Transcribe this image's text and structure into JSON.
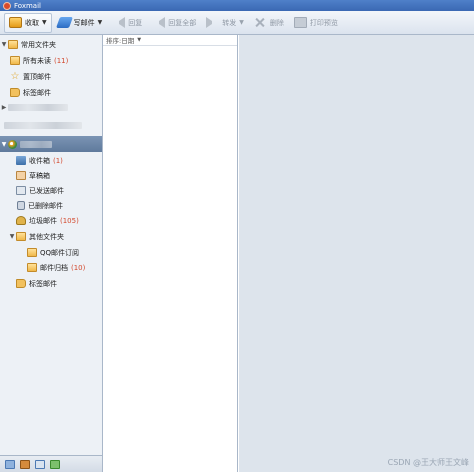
{
  "window": {
    "title": "Foxmail"
  },
  "toolbar": {
    "receive": "收取",
    "compose": "写邮件",
    "reply": "回复",
    "reply_all": "回复全部",
    "forward": "转发",
    "delete": "删除",
    "print_preview": "打印预览"
  },
  "sidebar": {
    "common_folders": {
      "title": "常用文件夹",
      "items": [
        {
          "label": "所有未读",
          "count": "(11)"
        },
        {
          "label": "置顶邮件"
        },
        {
          "label": "标签邮件"
        }
      ]
    },
    "account_folders": {
      "inbox": {
        "label": "收件箱",
        "count": "(1)"
      },
      "drafts": {
        "label": "草稿箱"
      },
      "sent": {
        "label": "已发送邮件"
      },
      "deleted": {
        "label": "已删除邮件"
      },
      "junk": {
        "label": "垃圾邮件",
        "count": "(105)"
      },
      "other": {
        "label": "其他文件夹"
      },
      "qq_subscriptions": {
        "label": "QQ邮件订阅"
      },
      "archive": {
        "label": "邮件归档",
        "count": "(10)"
      },
      "tags": {
        "label": "标签邮件"
      }
    }
  },
  "maillist": {
    "sort_label": "排序:日期"
  },
  "watermark": "CSDN @王大师王文峰"
}
